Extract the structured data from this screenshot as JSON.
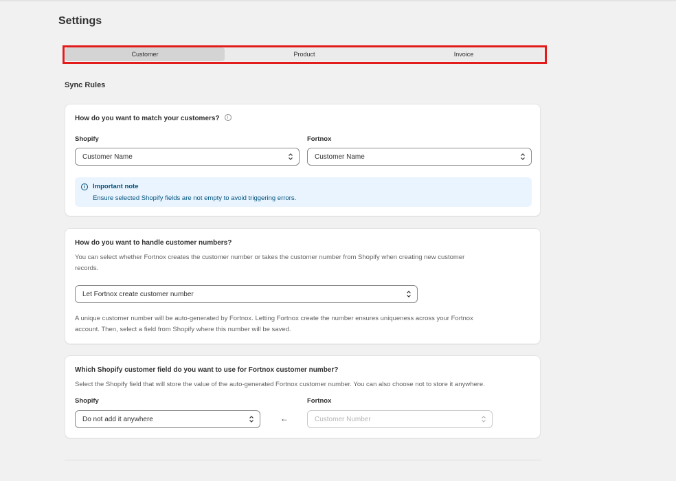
{
  "page": {
    "title": "Settings"
  },
  "tabs": [
    {
      "label": "Customer",
      "active": true
    },
    {
      "label": "Product",
      "active": false
    },
    {
      "label": "Invoice",
      "active": false
    }
  ],
  "section": {
    "heading": "Sync Rules"
  },
  "match_card": {
    "question": "How do you want to match your customers?",
    "info_icon": "info-icon",
    "shopify_label": "Shopify",
    "shopify_value": "Customer Name",
    "fortnox_label": "Fortnox",
    "fortnox_value": "Customer Name",
    "note_title": "Important note",
    "note_text": "Ensure selected Shopify fields are not empty to avoid triggering errors."
  },
  "number_card": {
    "question": "How do you want to handle customer numbers?",
    "description_line1": "You can select whether Fortnox creates the customer number or takes the customer number from Shopify when creating new customer",
    "description_line2": "records.",
    "select_value": "Let Fortnox create customer number",
    "help_line1": "A unique customer number will be auto-generated by Fortnox. Letting Fortnox create the number ensures uniqueness across your Fortnox",
    "help_line2": "account. Then, select a field from Shopify where this number will be saved."
  },
  "field_card": {
    "question_prefix": "Which Shopify customer field do you want to use for ",
    "question_emphasis": "Fortnox",
    "question_suffix": " customer number?",
    "description": "Select the Shopify field that will store the value of the auto-generated Fortnox customer number. You can also choose not to store it anywhere.",
    "shopify_label": "Shopify",
    "shopify_value": "Do not add it anywhere",
    "arrow": "←",
    "fortnox_label": "Fortnox",
    "fortnox_placeholder": "Customer Number"
  },
  "colors": {
    "background": "#f1f1f1",
    "highlight_border": "#e31b1b",
    "note_background": "#eaf4ff",
    "note_text": "#00527c"
  }
}
